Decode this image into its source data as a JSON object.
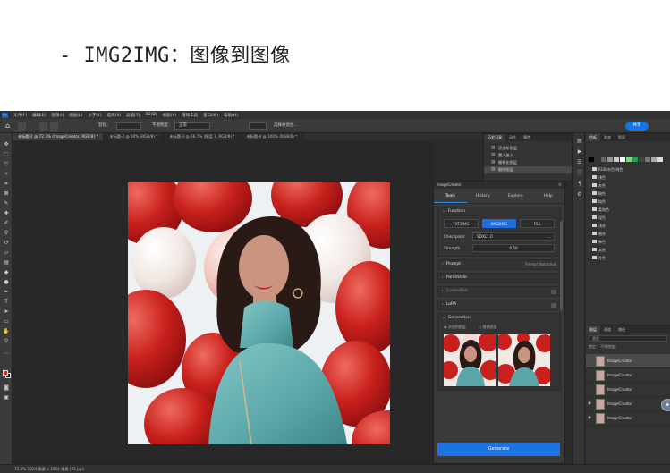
{
  "heading": "- IMG2IMG：图像到图像",
  "menubar": {
    "logo": "Ps",
    "items": [
      "文件(F)",
      "编辑(E)",
      "图像(I)",
      "图层(L)",
      "文字(Y)",
      "选择(S)",
      "滤镜(T)",
      "3D(D)",
      "视图(V)",
      "增效工具",
      "窗口(W)",
      "帮助(H)"
    ]
  },
  "options": {
    "mode_label": "不透明度：",
    "mode_value": "正常",
    "feather_label": "羽化：",
    "select_subject": "选择并遮住...",
    "share": "共享"
  },
  "tabs": [
    {
      "label": "未标题-1 @ 72.3% (ImageCreator, RGB/8) *",
      "active": true
    },
    {
      "label": "未标题-2 @ 50% (RGB/8) *",
      "active": false
    },
    {
      "label": "未标题-3 @ 66.7% (图层 1, RGB/8) *",
      "active": false
    },
    {
      "label": "未标题-4 @ 100% (RGB/8) *",
      "active": false
    }
  ],
  "plugin": {
    "header": "ImageCreator",
    "tabs": [
      "Tools",
      "History",
      "Explore",
      "Help"
    ],
    "active_tab": "Tools",
    "function": {
      "title": "Function",
      "buttons": [
        "TXT2IMG",
        "IMG2IMG",
        "FILL"
      ],
      "active": "IMG2IMG"
    },
    "checkpoint": {
      "label": "Checkpoint",
      "value": "SDXL1.0"
    },
    "strength": {
      "label": "Strength",
      "value": "0.50"
    },
    "prompt": {
      "title": "Prompt",
      "right": "Prompt Notebook"
    },
    "parameter": {
      "title": "Parameter"
    },
    "controlnet": {
      "title": "ControlNet"
    },
    "lora": {
      "title": "LoRA"
    },
    "generation": {
      "title": "Generation",
      "options": [
        "添加到图层",
        "替换图层"
      ]
    },
    "generate_button": "Generate"
  },
  "history": {
    "tabs": [
      "历史记录",
      "动作",
      "属性"
    ],
    "items": [
      "添加新图层",
      "置入嵌入",
      "栅格化图层",
      "删除图层"
    ],
    "selected": 3
  },
  "right_panel": {
    "tabs": [
      "色板",
      "渐变",
      "图案"
    ],
    "swatch_colors": [
      "#000000",
      "#333333",
      "#666666",
      "#999999",
      "#cccccc",
      "#ffffff",
      "#6ee07a",
      "#1ea64a",
      "#444444",
      "#777777",
      "#aaaaaa",
      "#dddddd"
    ],
    "folders": [
      "RGB/灰色/纯色",
      "浅色",
      "灰色",
      "暗色",
      "纯色",
      "柔和色",
      "深色",
      "浅灰",
      "暗灰",
      "单色",
      "其他",
      "冷色"
    ]
  },
  "layers": {
    "tabs": [
      "图层",
      "通道",
      "路径"
    ],
    "search": "类型",
    "opts": "锁定：    不透明度：",
    "items": [
      {
        "name": "ImageCreator",
        "visible": false
      },
      {
        "name": "ImageCreator",
        "visible": false
      },
      {
        "name": "ImageCreator",
        "visible": false
      },
      {
        "name": "ImageCreator",
        "visible": true
      },
      {
        "name": "ImageCreator",
        "visible": true
      }
    ]
  },
  "status": "72.3%    1024 像素 x 1024 像素 (72 ppi)"
}
